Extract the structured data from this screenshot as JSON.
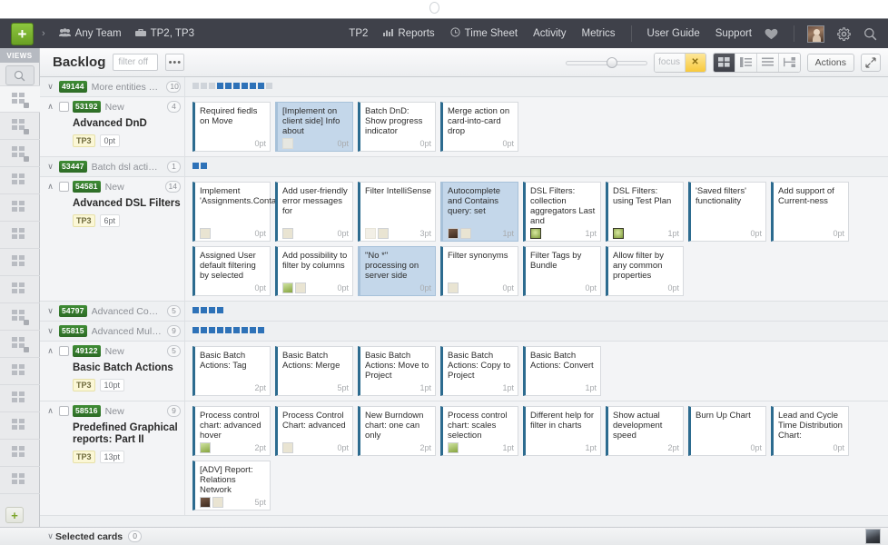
{
  "topbar": {
    "add_label": "+",
    "chevron": "›",
    "team_icon": "people-icon",
    "team_label": "Any Team",
    "project_icon": "briefcase-icon",
    "project_label": "TP2, TP3",
    "right_items": [
      {
        "label": "TP2",
        "icon": ""
      },
      {
        "label": "Reports",
        "icon": "bar-chart-icon"
      },
      {
        "label": "Time Sheet",
        "icon": "clock-icon"
      },
      {
        "label": "Activity",
        "icon": ""
      },
      {
        "label": "Metrics",
        "icon": ""
      }
    ],
    "right_items2": [
      {
        "label": "User Guide"
      },
      {
        "label": "Support"
      }
    ],
    "heart_icon": "heart-icon",
    "avatar": "user-avatar",
    "gear_icon": "gear-icon",
    "search_icon": "search-icon",
    "bg_color": "#3f414a"
  },
  "views_rail": {
    "label": "VIEWS",
    "search_icon": "search-icon",
    "add_label": "+",
    "items": [
      {
        "name": "view-board-locked-1",
        "locked": true
      },
      {
        "name": "view-board-locked-2",
        "locked": true
      },
      {
        "name": "view-board-locked-3",
        "locked": true
      },
      {
        "name": "view-board-4",
        "locked": false
      },
      {
        "name": "view-board-5",
        "locked": false
      },
      {
        "name": "view-board-6",
        "locked": false
      },
      {
        "name": "view-list-7",
        "locked": false
      },
      {
        "name": "view-board-8",
        "locked": false
      },
      {
        "name": "view-board-locked-9",
        "locked": true
      },
      {
        "name": "view-board-locked-10",
        "locked": true
      },
      {
        "name": "view-board-11",
        "locked": false
      },
      {
        "name": "view-board-12",
        "locked": false
      },
      {
        "name": "view-board-13",
        "locked": false
      },
      {
        "name": "view-board-14",
        "locked": false
      },
      {
        "name": "view-board-15",
        "locked": false
      }
    ]
  },
  "toolbar": {
    "title": "Backlog",
    "filter_value": "",
    "filter_placeholder": "filter off",
    "more_label": "•••",
    "zoom_value": 50,
    "focus_label": "focus",
    "focus_close": "✕",
    "view_buttons": [
      {
        "name": "view-cards-button",
        "active": true
      },
      {
        "name": "view-list-button",
        "active": false
      },
      {
        "name": "view-rows-button",
        "active": false
      },
      {
        "name": "view-timeline-button",
        "active": false
      }
    ],
    "actions_label": "Actions",
    "expand_icon": "expand-icon",
    "accent_amber": "#f8c93c"
  },
  "board": {
    "rows": [
      {
        "type": "collapsed",
        "id": "49144",
        "title": "More entities on Boa",
        "count": "10",
        "chevron": "∨",
        "checkbox": false,
        "squares": [
          "gray",
          "gray",
          "gray",
          "blue",
          "blue",
          "blue",
          "blue",
          "blue",
          "blue",
          "gray"
        ]
      },
      {
        "type": "expanded",
        "id": "53192",
        "state": "New",
        "count": "4",
        "chevron": "∧",
        "checkbox": true,
        "name": "Advanced DnD",
        "project": "TP3",
        "points": "0pt",
        "cards": [
          {
            "title": "Required fiedls on Move",
            "pt": "0pt",
            "avatars": [],
            "selected": false
          },
          {
            "title": "[Implement on client side] Info about",
            "pt": "0pt",
            "avatars": [
              "ghost"
            ],
            "selected": true
          },
          {
            "title": "Batch DnD: Show progress indicator",
            "pt": "0pt",
            "avatars": [],
            "selected": false
          },
          {
            "title": "Merge action on card-into-card drop",
            "pt": "0pt",
            "avatars": [],
            "selected": false
          }
        ]
      },
      {
        "type": "collapsed",
        "id": "53447",
        "title": "Batch dsl actions",
        "count": "1",
        "chevron": "∨",
        "checkbox": false,
        "squares": [
          "blue",
          "blue"
        ]
      },
      {
        "type": "expanded",
        "id": "54581",
        "state": "New",
        "count": "14",
        "chevron": "∧",
        "checkbox": true,
        "name": "Advanced DSL Filters",
        "project": "TP3",
        "points": "6pt",
        "cards": [
          {
            "title": "Implement 'Assignments.Contain",
            "pt": "0pt",
            "avatars": [
              "pale"
            ],
            "selected": false
          },
          {
            "title": "Add user-friendly error messages for",
            "pt": "0pt",
            "avatars": [
              "pale"
            ],
            "selected": false
          },
          {
            "title": "Filter IntelliSense",
            "pt": "3pt",
            "avatars": [
              "ghost",
              "pale"
            ],
            "selected": false
          },
          {
            "title": "Autocomplete and Contains query: set",
            "pt": "1pt",
            "avatars": [
              "person",
              "pale"
            ],
            "selected": true
          },
          {
            "title": "DSL Filters: collection aggregators Last and",
            "pt": "1pt",
            "avatars": [
              "green"
            ],
            "selected": false
          },
          {
            "title": "DSL Filters: using Test Plan",
            "pt": "1pt",
            "avatars": [
              "green"
            ],
            "selected": false
          },
          {
            "title": "'Saved filters' functionality",
            "pt": "0pt",
            "avatars": [],
            "selected": false
          },
          {
            "title": "Add support of Current-ness",
            "pt": "0pt",
            "avatars": [],
            "selected": false
          },
          {
            "title": "Assigned User default filtering by selected",
            "pt": "0pt",
            "avatars": [],
            "selected": false
          },
          {
            "title": "Add possibility to filter by columns",
            "pt": "0pt",
            "avatars": [
              "greenp",
              "pale"
            ],
            "selected": false
          },
          {
            "title": "\"No *\" processing on server side",
            "pt": "0pt",
            "avatars": [],
            "selected": true
          },
          {
            "title": "Filter synonyms",
            "pt": "0pt",
            "avatars": [
              "pale"
            ],
            "selected": false
          },
          {
            "title": "Filter Tags by Bundle",
            "pt": "0pt",
            "avatars": [],
            "selected": false
          },
          {
            "title": "Allow filter by any common properties",
            "pt": "0pt",
            "avatars": [],
            "selected": false
          }
        ]
      },
      {
        "type": "collapsed",
        "id": "54797",
        "title": "Advanced Comet Supp",
        "count": "5",
        "chevron": "∨",
        "checkbox": false,
        "squares": [
          "blue",
          "blue",
          "blue",
          "blue"
        ]
      },
      {
        "type": "collapsed",
        "id": "55815",
        "title": "Advanced Multi-Team",
        "count": "9",
        "chevron": "∨",
        "checkbox": false,
        "squares": [
          "blue",
          "blue",
          "blue",
          "blue",
          "blue",
          "blue",
          "blue",
          "blue",
          "blue"
        ]
      },
      {
        "type": "expanded",
        "id": "49122",
        "state": "New",
        "count": "5",
        "chevron": "∧",
        "checkbox": true,
        "name": "Basic Batch Actions",
        "project": "TP3",
        "points": "10pt",
        "cards": [
          {
            "title": "Basic Batch Actions: Tag",
            "pt": "2pt",
            "avatars": [],
            "selected": false
          },
          {
            "title": "Basic Batch Actions: Merge",
            "pt": "5pt",
            "avatars": [],
            "selected": false
          },
          {
            "title": "Basic Batch Actions: Move to Project",
            "pt": "1pt",
            "avatars": [],
            "selected": false
          },
          {
            "title": "Basic Batch Actions: Copy to Project",
            "pt": "1pt",
            "avatars": [],
            "selected": false
          },
          {
            "title": "Basic Batch Actions: Convert",
            "pt": "1pt",
            "avatars": [],
            "selected": false
          }
        ]
      },
      {
        "type": "expanded",
        "id": "58516",
        "state": "New",
        "count": "9",
        "chevron": "∧",
        "checkbox": true,
        "name": "Predefined Graphical reports: Part II",
        "project": "TP3",
        "points": "13pt",
        "cards": [
          {
            "title": "Process control chart: advanced hover",
            "pt": "2pt",
            "avatars": [
              "greenp"
            ],
            "selected": false
          },
          {
            "title": "Process Control Chart: advanced",
            "pt": "0pt",
            "avatars": [
              "pale"
            ],
            "selected": false
          },
          {
            "title": "New Burndown chart: one can only",
            "pt": "2pt",
            "avatars": [],
            "selected": false
          },
          {
            "title": "Process control chart: scales selection",
            "pt": "1pt",
            "avatars": [
              "greenp"
            ],
            "selected": false
          },
          {
            "title": "Different help for filter in charts",
            "pt": "1pt",
            "avatars": [],
            "selected": false
          },
          {
            "title": "Show actual development speed",
            "pt": "2pt",
            "avatars": [],
            "selected": false
          },
          {
            "title": "Burn Up Chart",
            "pt": "0pt",
            "avatars": [],
            "selected": false
          },
          {
            "title": "Lead and Cycle Time Distribution Chart:",
            "pt": "0pt",
            "avatars": [],
            "selected": false
          },
          {
            "title": "[ADV] Report: Relations Network",
            "pt": "5pt",
            "avatars": [
              "person",
              "pale"
            ],
            "selected": false
          }
        ]
      }
    ]
  },
  "bottombar": {
    "chevron": "∨",
    "label": "Selected cards",
    "count": "0",
    "avatar": "user-avatar"
  }
}
